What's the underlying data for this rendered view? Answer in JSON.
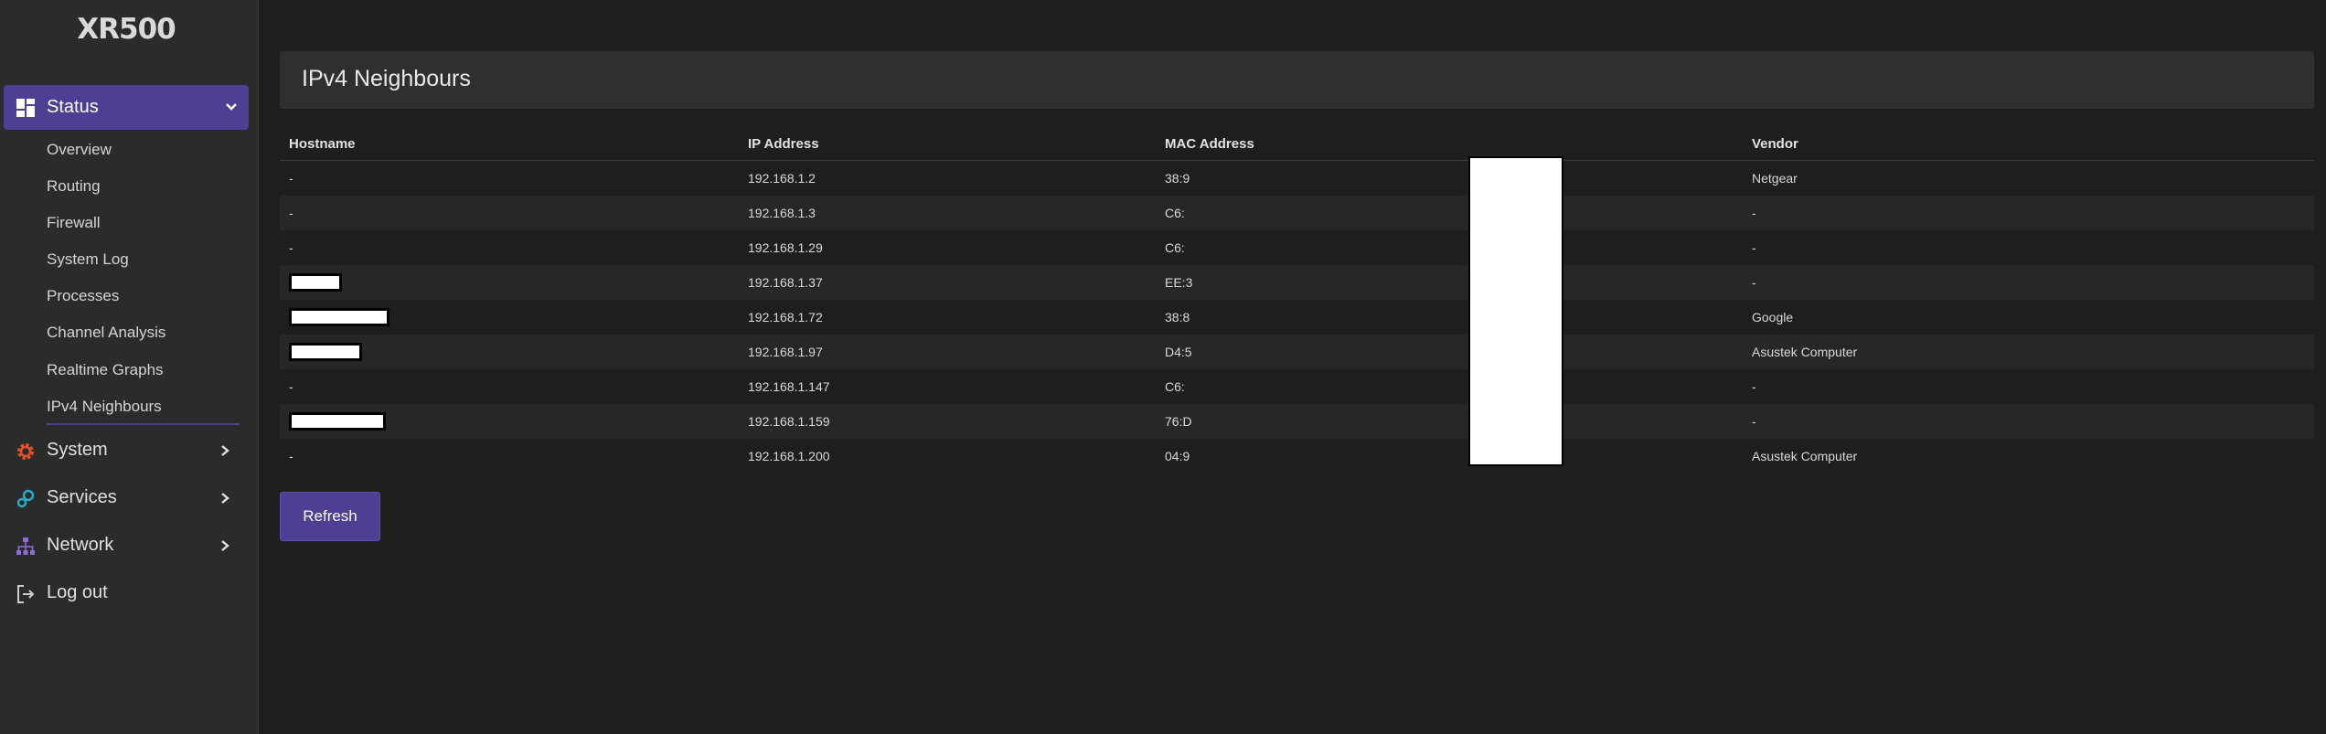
{
  "app": {
    "title": "XR500"
  },
  "sidebar": {
    "status": {
      "label": "Status",
      "icon": "dashboard-icon"
    },
    "status_items": [
      {
        "label": "Overview"
      },
      {
        "label": "Routing"
      },
      {
        "label": "Firewall"
      },
      {
        "label": "System Log"
      },
      {
        "label": "Processes"
      },
      {
        "label": "Channel Analysis"
      },
      {
        "label": "Realtime Graphs"
      },
      {
        "label": "IPv4 Neighbours",
        "active": true
      }
    ],
    "menus": [
      {
        "label": "System",
        "icon": "gear-icon",
        "color": "#e0522a"
      },
      {
        "label": "Services",
        "icon": "cogs-icon",
        "color": "#2aa8c8"
      },
      {
        "label": "Network",
        "icon": "network-icon",
        "color": "#8c6cd6"
      },
      {
        "label": "Log out",
        "icon": "logout-icon",
        "color": "#cccccc"
      }
    ]
  },
  "main": {
    "title": "IPv4 Neighbours",
    "columns": [
      "Hostname",
      "IP Address",
      "MAC Address",
      "Vendor"
    ],
    "rows": [
      {
        "hostname": "-",
        "hostname_redacted": false,
        "ip": "192.168.1.2",
        "mac": "38:9",
        "vendor": "Netgear"
      },
      {
        "hostname": "-",
        "hostname_redacted": false,
        "ip": "192.168.1.3",
        "mac": "C6:",
        "vendor": "-"
      },
      {
        "hostname": "-",
        "hostname_redacted": false,
        "ip": "192.168.1.29",
        "mac": "C6:",
        "vendor": "-"
      },
      {
        "hostname": "",
        "hostname_redacted": true,
        "ip": "192.168.1.37",
        "mac": "EE:3",
        "vendor": "-"
      },
      {
        "hostname": "",
        "hostname_redacted": true,
        "ip": "192.168.1.72",
        "mac": "38:8",
        "vendor": "Google"
      },
      {
        "hostname": "",
        "hostname_redacted": true,
        "ip": "192.168.1.97",
        "mac": "D4:5",
        "vendor": "Asustek Computer"
      },
      {
        "hostname": "-",
        "hostname_redacted": false,
        "ip": "192.168.1.147",
        "mac": "C6:",
        "vendor": "-"
      },
      {
        "hostname": "",
        "hostname_redacted": true,
        "ip": "192.168.1.159",
        "mac": "76:D",
        "vendor": "-"
      },
      {
        "hostname": "-",
        "hostname_redacted": false,
        "ip": "192.168.1.200",
        "mac": "04:9",
        "vendor": "Asustek Computer"
      }
    ],
    "refresh_label": "Refresh"
  },
  "colors": {
    "accent": "#4e3f94",
    "background": "#1e1e1e",
    "sidebar": "#2b2b2b"
  }
}
